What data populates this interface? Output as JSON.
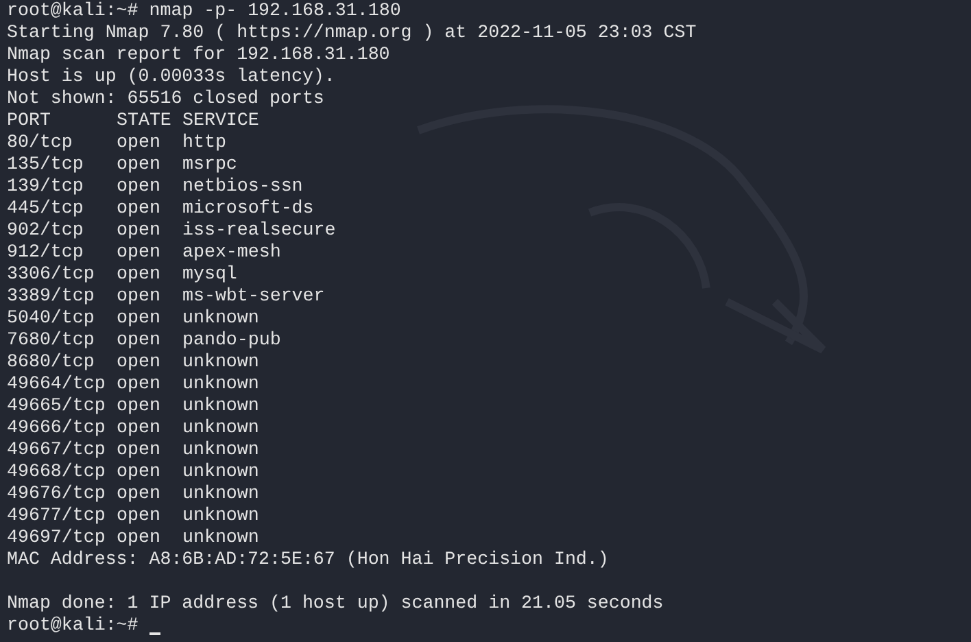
{
  "terminal": {
    "lines": [
      {
        "kind": "prompt",
        "prompt": "root@kali:~#",
        "command": "nmap -p- 192.168.31.180",
        "cursor": false
      },
      {
        "kind": "text",
        "text": "Starting Nmap 7.80 ( https://nmap.org ) at 2022-11-05 23:03 CST"
      },
      {
        "kind": "text",
        "text": "Nmap scan report for 192.168.31.180"
      },
      {
        "kind": "text",
        "text": "Host is up (0.00033s latency)."
      },
      {
        "kind": "text",
        "text": "Not shown: 65516 closed ports"
      },
      {
        "kind": "port",
        "port": "PORT",
        "state": "STATE",
        "service": "SERVICE"
      },
      {
        "kind": "port",
        "port": "80/tcp",
        "state": "open",
        "service": "http"
      },
      {
        "kind": "port",
        "port": "135/tcp",
        "state": "open",
        "service": "msrpc"
      },
      {
        "kind": "port",
        "port": "139/tcp",
        "state": "open",
        "service": "netbios-ssn"
      },
      {
        "kind": "port",
        "port": "445/tcp",
        "state": "open",
        "service": "microsoft-ds"
      },
      {
        "kind": "port",
        "port": "902/tcp",
        "state": "open",
        "service": "iss-realsecure"
      },
      {
        "kind": "port",
        "port": "912/tcp",
        "state": "open",
        "service": "apex-mesh"
      },
      {
        "kind": "port",
        "port": "3306/tcp",
        "state": "open",
        "service": "mysql"
      },
      {
        "kind": "port",
        "port": "3389/tcp",
        "state": "open",
        "service": "ms-wbt-server"
      },
      {
        "kind": "port",
        "port": "5040/tcp",
        "state": "open",
        "service": "unknown"
      },
      {
        "kind": "port",
        "port": "7680/tcp",
        "state": "open",
        "service": "pando-pub"
      },
      {
        "kind": "port",
        "port": "8680/tcp",
        "state": "open",
        "service": "unknown"
      },
      {
        "kind": "port",
        "port": "49664/tcp",
        "state": "open",
        "service": "unknown"
      },
      {
        "kind": "port",
        "port": "49665/tcp",
        "state": "open",
        "service": "unknown"
      },
      {
        "kind": "port",
        "port": "49666/tcp",
        "state": "open",
        "service": "unknown"
      },
      {
        "kind": "port",
        "port": "49667/tcp",
        "state": "open",
        "service": "unknown"
      },
      {
        "kind": "port",
        "port": "49668/tcp",
        "state": "open",
        "service": "unknown"
      },
      {
        "kind": "port",
        "port": "49676/tcp",
        "state": "open",
        "service": "unknown"
      },
      {
        "kind": "port",
        "port": "49677/tcp",
        "state": "open",
        "service": "unknown"
      },
      {
        "kind": "port",
        "port": "49697/tcp",
        "state": "open",
        "service": "unknown"
      },
      {
        "kind": "text",
        "text": "MAC Address: A8:6B:AD:72:5E:67 (Hon Hai Precision Ind.)"
      },
      {
        "kind": "blank"
      },
      {
        "kind": "text",
        "text": "Nmap done: 1 IP address (1 host up) scanned in 21.05 seconds"
      },
      {
        "kind": "prompt",
        "prompt": "root@kali:~#",
        "cursor": true
      }
    ]
  }
}
